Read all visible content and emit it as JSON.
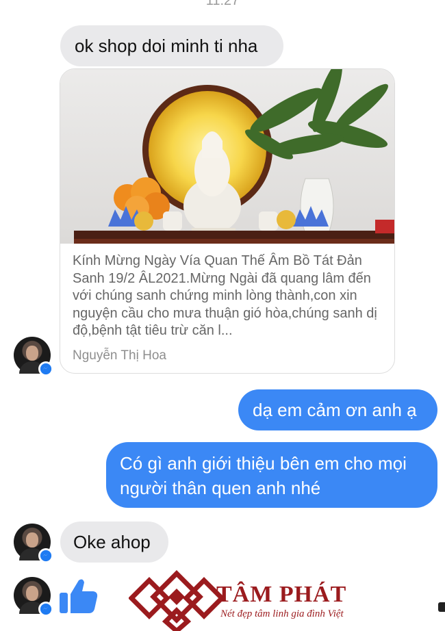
{
  "status": {
    "time": "11:27"
  },
  "messages": {
    "m1": "ok shop doi minh ti nha",
    "m2": "dạ em cảm ơn anh ạ",
    "m3": "Có gì anh giới thiệu bên em cho mọi người thân quen anh nhé",
    "m4": "Oke ahop"
  },
  "link_card": {
    "text": "Kính Mừng Ngày Vía Quan Thế Âm Bồ Tát Đản Sanh 19/2 ÂL2021.Mừng Ngài đã quang lâm đến với chúng sanh chứng minh lòng thành,con xin nguyện cầu cho mưa thuận gió hòa,chúng sanh dị độ,bệnh tật tiêu trừ căn l...",
    "author": "Nguyễn Thị Hoa"
  },
  "brand": {
    "name": "TÂM PHÁT",
    "tagline": "Nét đẹp tâm linh gia đình Việt",
    "color": "#9b1b1e"
  },
  "colors": {
    "incoming_bubble": "#e9e9eb",
    "outgoing_bubble": "#3b88f5",
    "messenger_badge": "#1f7bf2"
  },
  "icons": {
    "avatar_badge": "messenger-icon",
    "like": "thumbs-up-icon"
  }
}
